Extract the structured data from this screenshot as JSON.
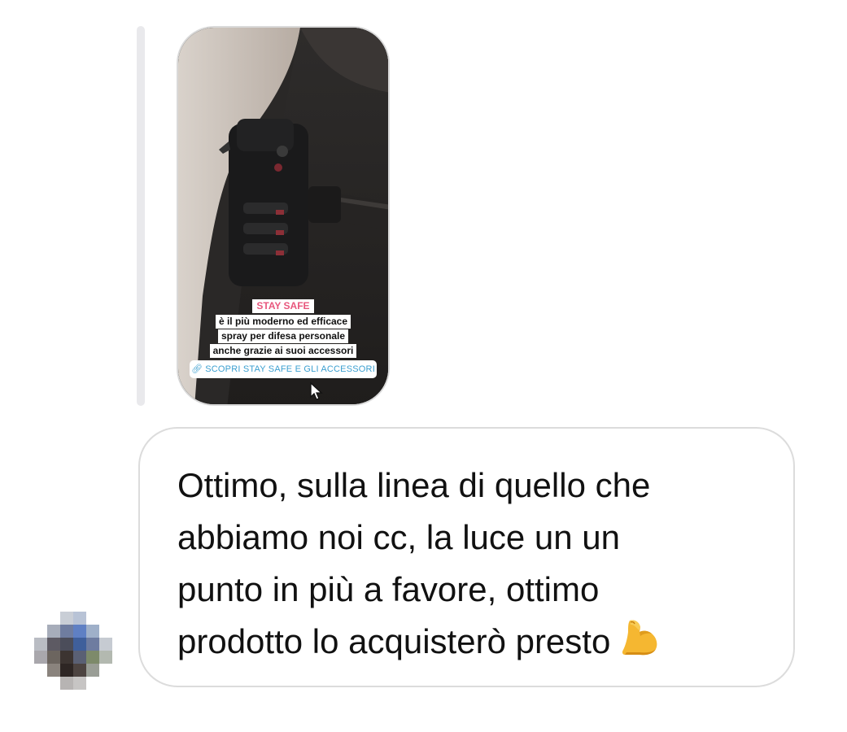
{
  "story_reply": {
    "caption": {
      "title": "STAY SAFE",
      "lines": [
        "è il più moderno ed efficace",
        "spray per difesa personale",
        "anche grazie ai suoi accessori"
      ]
    },
    "link_sticker": {
      "icon": "link-icon",
      "label": "SCOPRI STAY SAFE E GLI ACCESSORI"
    }
  },
  "message": {
    "text": "Ottimo, sulla linea di quello che\nabbiamo noi cc, la luce un un\npunto in più a favore, ottimo\nprodotto lo acquisterò presto",
    "emoji": "flexed-biceps-icon"
  },
  "sender": {
    "avatar": "avatar-pixelated"
  },
  "colors": {
    "caption_title": "#e8577d",
    "link_text": "#3b9fd0",
    "bubble_border": "#dcdcdc",
    "reply_line": "#e9e9ec"
  }
}
